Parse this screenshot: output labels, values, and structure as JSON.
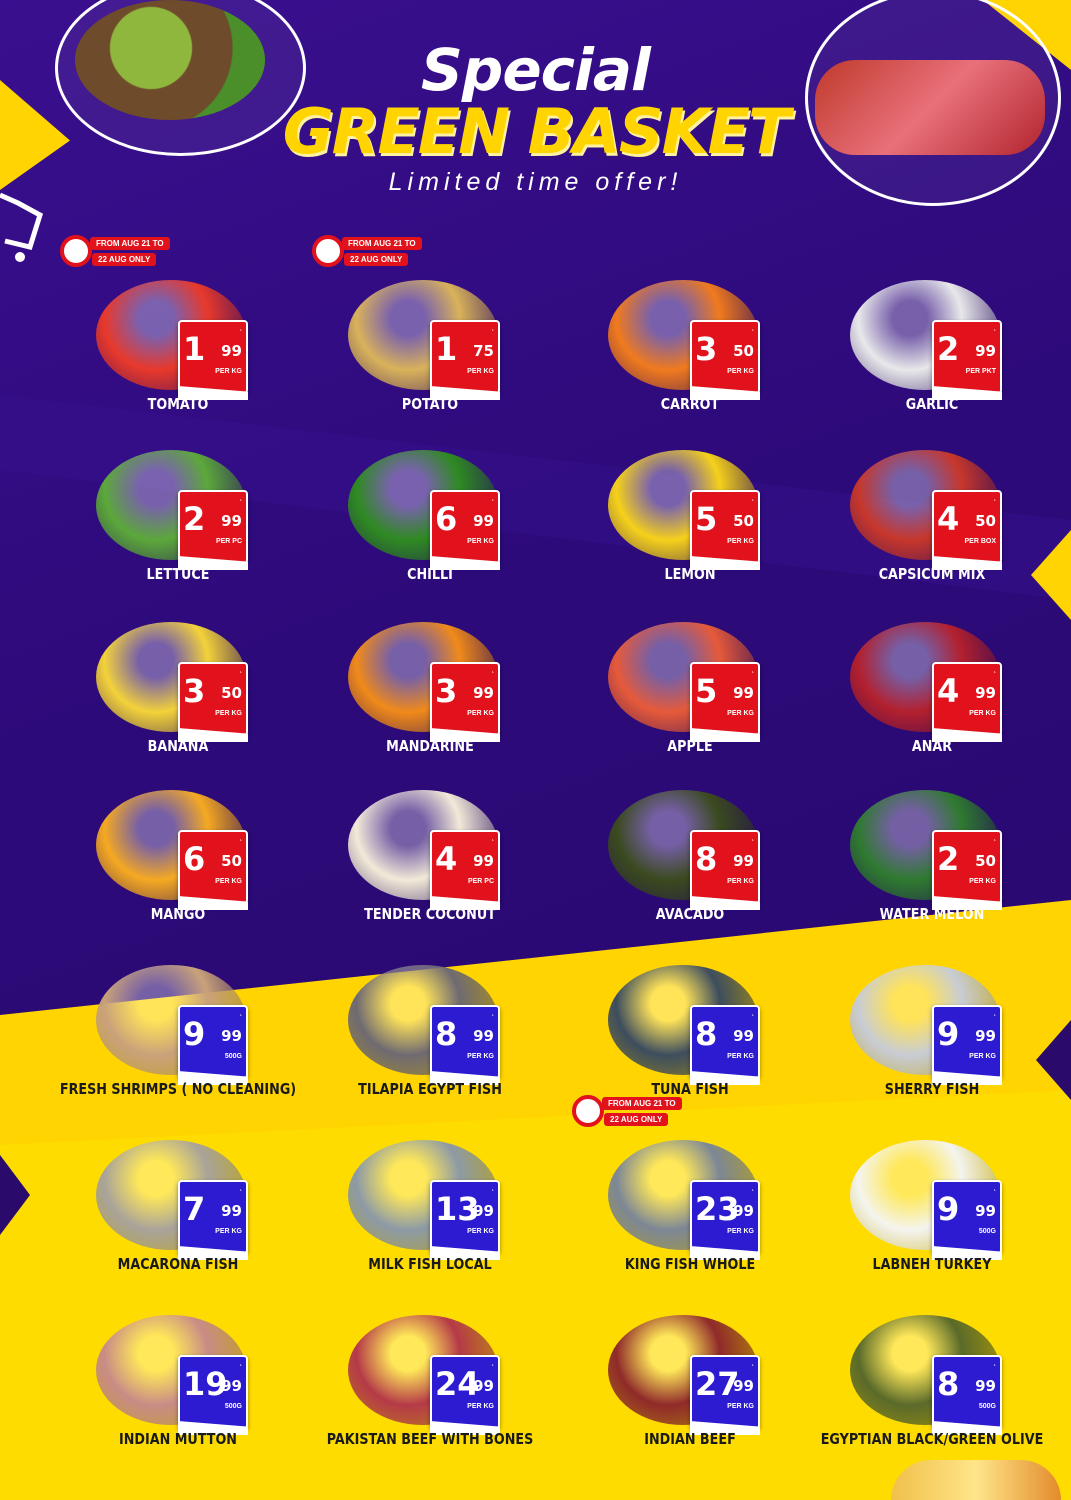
{
  "header": {
    "special": "Special",
    "title": "GREEN BASKET",
    "subtitle": "Limited time offer!"
  },
  "badge": {
    "line1": "FROM AUG 21 TO",
    "line2": "22 AUG ONLY"
  },
  "colors": {
    "purple": "#2d0a7a",
    "yellow": "#ffd400",
    "red_tag": "#e1121b",
    "blue_tag": "#2d1bd1"
  },
  "currency_icon": "dirham-icon",
  "items": [
    {
      "name": "TOMATO",
      "int": "1",
      "dec": "99",
      "unit": "PER KG",
      "color": "red",
      "pic": "#e8392b"
    },
    {
      "name": "POTATO",
      "int": "1",
      "dec": "75",
      "unit": "PER KG",
      "color": "red",
      "pic": "#d9b25a"
    },
    {
      "name": "CARROT",
      "int": "3",
      "dec": "50",
      "unit": "PER KG",
      "color": "red",
      "pic": "#f07a1e"
    },
    {
      "name": "GARLIC",
      "int": "2",
      "dec": "99",
      "unit": "PER PKT",
      "color": "red",
      "pic": "#e8e8ea"
    },
    {
      "name": "LETTUCE",
      "int": "2",
      "dec": "99",
      "unit": "PER PC",
      "color": "red",
      "pic": "#5ca83a"
    },
    {
      "name": "CHILLI",
      "int": "6",
      "dec": "99",
      "unit": "PER KG",
      "color": "red",
      "pic": "#2f8a22"
    },
    {
      "name": "LEMON",
      "int": "5",
      "dec": "50",
      "unit": "PER KG",
      "color": "red",
      "pic": "#f5d11a"
    },
    {
      "name": "CAPSICUM MIX",
      "int": "4",
      "dec": "50",
      "unit": "PER BOX",
      "color": "red",
      "pic": "#c7372b"
    },
    {
      "name": "BANANA",
      "int": "3",
      "dec": "50",
      "unit": "PER KG",
      "color": "red",
      "pic": "#f3d23a"
    },
    {
      "name": "MANDARINE",
      "int": "3",
      "dec": "99",
      "unit": "PER KG",
      "color": "red",
      "pic": "#f08a1a"
    },
    {
      "name": "APPLE",
      "int": "5",
      "dec": "99",
      "unit": "PER KG",
      "color": "red",
      "pic": "#e65a3a"
    },
    {
      "name": "ANAR",
      "int": "4",
      "dec": "99",
      "unit": "PER KG",
      "color": "red",
      "pic": "#b3202e"
    },
    {
      "name": "MANGO",
      "int": "6",
      "dec": "50",
      "unit": "PER KG",
      "color": "red",
      "pic": "#f5a922"
    },
    {
      "name": "TENDER COCONUT",
      "int": "4",
      "dec": "99",
      "unit": "PER PC",
      "color": "red",
      "pic": "#f2ead8"
    },
    {
      "name": "AVACADO",
      "int": "8",
      "dec": "99",
      "unit": "PER KG",
      "color": "red",
      "pic": "#3a4a1e"
    },
    {
      "name": "WATER MELON",
      "int": "2",
      "dec": "50",
      "unit": "PER KG",
      "color": "red",
      "pic": "#2f7a30"
    },
    {
      "name": "FRESH SHRIMPS ( NO CLEANING)",
      "int": "9",
      "dec": "99",
      "unit": "500G",
      "color": "blue",
      "pic": "#c9a27a"
    },
    {
      "name": "TILAPIA EGYPT FISH",
      "int": "8",
      "dec": "99",
      "unit": "PER KG",
      "color": "blue",
      "pic": "#6f6a72"
    },
    {
      "name": "TUNA FISH",
      "int": "8",
      "dec": "99",
      "unit": "PER KG",
      "color": "blue",
      "pic": "#3d4d5e"
    },
    {
      "name": "SHERRY FISH",
      "int": "9",
      "dec": "99",
      "unit": "PER KG",
      "color": "blue",
      "pic": "#c8ccd4"
    },
    {
      "name": "MACARONA  FISH",
      "int": "7",
      "dec": "99",
      "unit": "PER KG",
      "color": "blue",
      "pic": "#a9a39a"
    },
    {
      "name": "MILK FISH LOCAL",
      "int": "13",
      "dec": "99",
      "unit": "PER KG",
      "color": "blue",
      "pic": "#8d9aa6"
    },
    {
      "name": "KING FISH WHOLE",
      "int": "23",
      "dec": "99",
      "unit": "PER KG",
      "color": "blue",
      "pic": "#7d8796"
    },
    {
      "name": "LABNEH TURKEY",
      "int": "9",
      "dec": "99",
      "unit": "500G",
      "color": "blue",
      "pic": "#f4f4ef"
    },
    {
      "name": "INDIAN MUTTON",
      "int": "19",
      "dec": "99",
      "unit": "500G",
      "color": "blue",
      "pic": "#c98c86"
    },
    {
      "name": "PAKISTAN BEEF WITH BONES",
      "int": "24",
      "dec": "99",
      "unit": "PER KG",
      "color": "blue",
      "pic": "#b53a48"
    },
    {
      "name": "INDIAN BEEF",
      "int": "27",
      "dec": "99",
      "unit": "PER KG",
      "color": "blue",
      "pic": "#8f2a2a"
    },
    {
      "name": "EGYPTIAN BLACK/GREEN OLIVE",
      "int": "8",
      "dec": "99",
      "unit": "500G",
      "color": "blue",
      "pic": "#5a6a2a"
    }
  ],
  "badged_items": [
    0,
    1,
    22
  ]
}
